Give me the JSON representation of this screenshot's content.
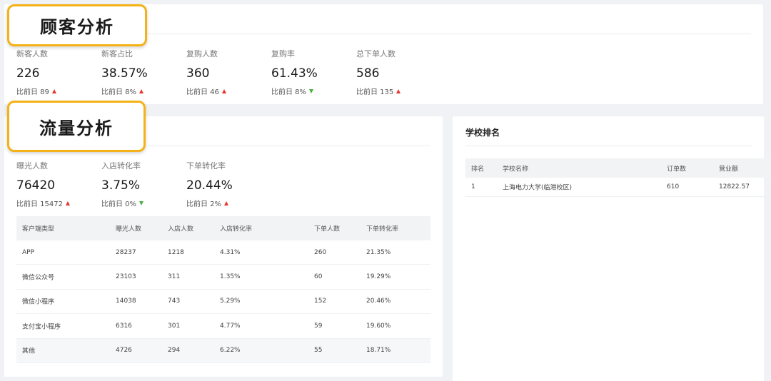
{
  "customer": {
    "callout": "顾客分析",
    "stats": [
      {
        "label": "新客人数",
        "value": "226",
        "compare": "比前日 89",
        "trend": "up"
      },
      {
        "label": "新客占比",
        "value": "38.57%",
        "compare": "比前日 8%",
        "trend": "up"
      },
      {
        "label": "复购人数",
        "value": "360",
        "compare": "比前日 46",
        "trend": "up"
      },
      {
        "label": "复购率",
        "value": "61.43%",
        "compare": "比前日 8%",
        "trend": "down"
      },
      {
        "label": "总下单人数",
        "value": "586",
        "compare": "比前日 135",
        "trend": "up"
      }
    ]
  },
  "traffic": {
    "callout": "流量分析",
    "stats": [
      {
        "label": "曝光人数",
        "value": "76420",
        "compare": "比前日 15472",
        "trend": "up"
      },
      {
        "label": "入店转化率",
        "value": "3.75%",
        "compare": "比前日 0%",
        "trend": "down"
      },
      {
        "label": "下单转化率",
        "value": "20.44%",
        "compare": "比前日 2%",
        "trend": "up"
      }
    ],
    "table": {
      "headers": [
        "客户端类型",
        "曝光人数",
        "入店人数",
        "入店转化率",
        "下单人数",
        "下单转化率"
      ],
      "rows": [
        [
          "APP",
          "28237",
          "1218",
          "4.31%",
          "260",
          "21.35%"
        ],
        [
          "微信公众号",
          "23103",
          "311",
          "1.35%",
          "60",
          "19.29%"
        ],
        [
          "微信小程序",
          "14038",
          "743",
          "5.29%",
          "152",
          "20.46%"
        ],
        [
          "支付宝小程序",
          "6316",
          "301",
          "4.77%",
          "59",
          "19.60%"
        ],
        [
          "其他",
          "4726",
          "294",
          "6.22%",
          "55",
          "18.71%"
        ]
      ]
    }
  },
  "school": {
    "title": "学校排名",
    "table": {
      "headers": [
        "排名",
        "学校名称",
        "订单数",
        "营业额"
      ],
      "rows": [
        [
          "1",
          "上海电力大学(临港校区)",
          "610",
          "12822.57"
        ]
      ]
    }
  },
  "colors": {
    "trend_up": "#e8342b",
    "trend_down": "#49b043",
    "callout_border": "#f5b216"
  }
}
